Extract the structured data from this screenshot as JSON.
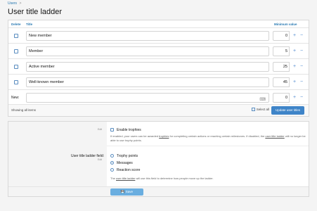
{
  "breadcrumb": {
    "item": "Users",
    "separator": ">"
  },
  "page": {
    "title": "User title ladder"
  },
  "ladder": {
    "headers": {
      "delete": "Delete",
      "title": "Title",
      "minimum": "Minimum value"
    },
    "rows": [
      {
        "title": "New member",
        "value": "0"
      },
      {
        "title": "Member",
        "value": "5"
      },
      {
        "title": "Active member",
        "value": "25"
      },
      {
        "title": "Well-known member",
        "value": "45"
      }
    ],
    "new_row": {
      "label": "New:",
      "title": "",
      "value": "0",
      "icon": "keyboard-icon"
    },
    "plus": "+",
    "minus": "−",
    "footer": {
      "showing": "Showing all items",
      "select_all": "Select all",
      "update_button": "Update user titles"
    }
  },
  "options": {
    "edit_label": "Edit",
    "enable": {
      "label": "Enable trophies",
      "description_pre": "If enabled, your users can be awarded ",
      "description_link": "trophies",
      "description_mid": " for completing certain actions or reaching certain milestones. If disabled, the ",
      "description_link2": "user title ladder",
      "description_post": " will no longer be able to use trophy points."
    },
    "field": {
      "label": "User title ladder field:",
      "choices": [
        {
          "label": "Trophy points",
          "selected": false
        },
        {
          "label": "Messages",
          "selected": true
        },
        {
          "label": "Reaction score",
          "selected": false
        }
      ],
      "hint_pre": "The ",
      "hint_link": "user title ladder",
      "hint_post": " will use this field to determine how people move up the ladder."
    },
    "save_button": "Save",
    "save_icon": "save-icon"
  },
  "colors": {
    "accent": "#2577b1",
    "button": "#3e84c8",
    "save": "#6aaee0"
  }
}
